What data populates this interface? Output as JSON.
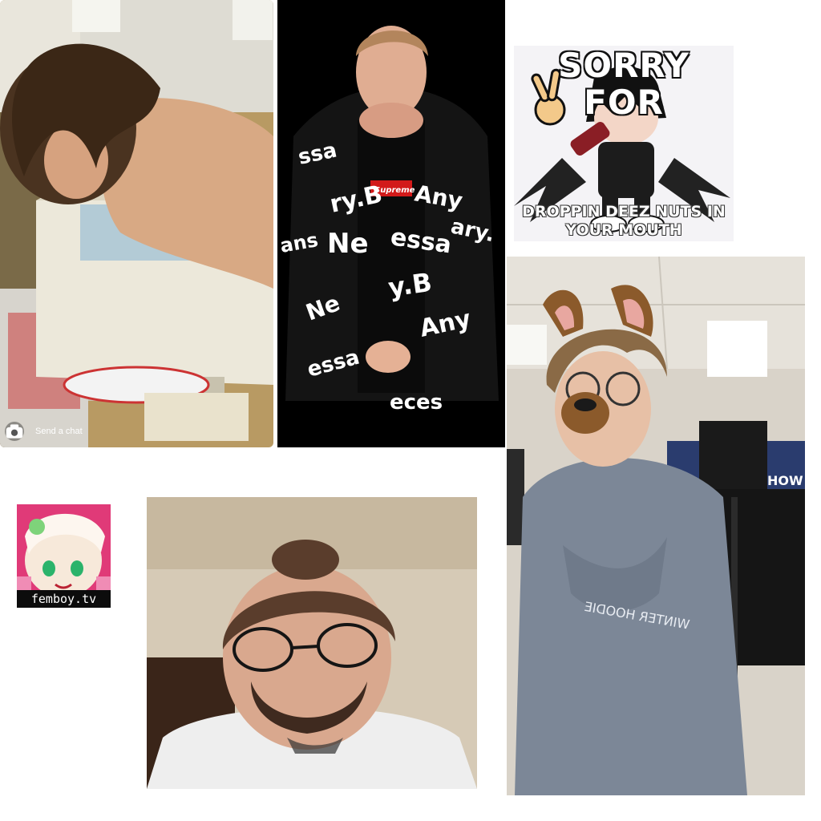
{
  "collage": {
    "photo_snap": {
      "description_icon": "camera-icon",
      "chat_placeholder": "Send a chat"
    },
    "photo_jacket": {
      "print_words": [
        "ssa",
        "ry.B",
        "Any",
        "Ne",
        "essa",
        "ary.",
        "ans",
        "y.B",
        "Any",
        "Ne",
        "essa",
        "eces"
      ],
      "logo_text": "Supreme"
    },
    "meme": {
      "top_text": "SORRY FOR",
      "bottom_text_line1": "DROPPIN DEEZ NUTS IN",
      "bottom_text_line2": "YOUR MOUTH"
    },
    "photo_classroom": {
      "hoodie_text": "WINTER HOODIE",
      "banner_text": "HOW"
    },
    "logo_tile": {
      "caption": "femboy.tv"
    },
    "colors": {
      "background": "#ffffff",
      "hoodie": "#7c8797",
      "jacket": "#111111",
      "meme_bg": "#f4f3f6",
      "logo_pink": "#e03a78"
    }
  }
}
